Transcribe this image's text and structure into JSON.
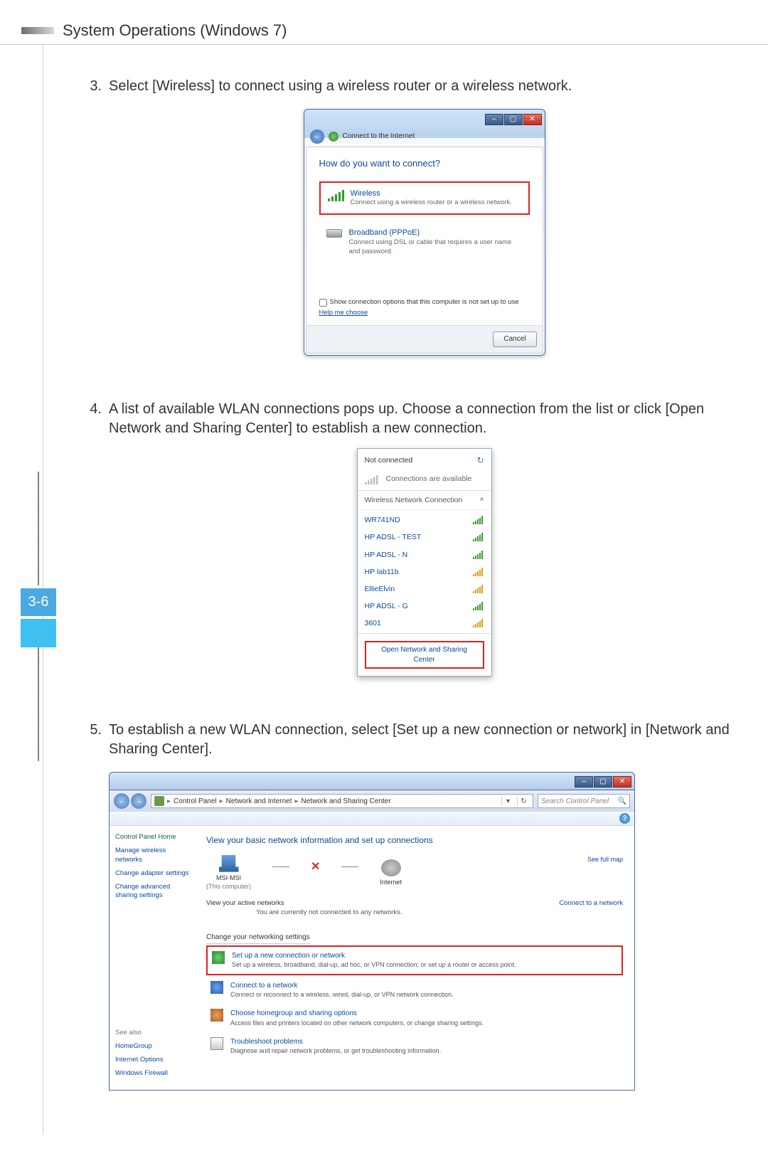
{
  "header": {
    "title": "System Operations (Windows 7)"
  },
  "page_number": "3-6",
  "steps": {
    "s3": {
      "num": "3.",
      "text": "Select [Wireless] to connect using a wireless router or a wireless network."
    },
    "s4": {
      "num": "4.",
      "text": "A list of available WLAN connections pops up. Choose a connection from the list or click [Open Network and Sharing Center] to establish a new connection."
    },
    "s5": {
      "num": "5.",
      "text": "To establish a new WLAN connection, select [Set up a new connection or network] in [Network and Sharing Center]."
    }
  },
  "dialog1": {
    "breadcrumb": "Connect to the Internet",
    "question": "How do you want to connect?",
    "opt_wireless": {
      "title": "Wireless",
      "desc": "Connect using a wireless router or a wireless network."
    },
    "opt_pppoe": {
      "title": "Broadband (PPPoE)",
      "desc": "Connect using DSL or cable that requires a user name and password."
    },
    "show_options": "Show connection options that this computer is not set up to use",
    "help": "Help me choose",
    "cancel": "Cancel"
  },
  "wifi_popup": {
    "not_connected": "Not connected",
    "available": "Connections are available",
    "section": "Wireless Network Connection",
    "items": [
      "WR741ND",
      "HP ADSL - TEST",
      "HP ADSL - N",
      "HP lab11b",
      "EllieElvin",
      "HP ADSL - G",
      "3601"
    ],
    "open_link": "Open Network and Sharing Center"
  },
  "nsc": {
    "crumbs": [
      "Control Panel",
      "Network and Internet",
      "Network and Sharing Center"
    ],
    "search_placeholder": "Search Control Panel",
    "side": {
      "home": "Control Panel Home",
      "links": [
        "Manage wireless networks",
        "Change adapter settings",
        "Change advanced sharing settings"
      ],
      "see_also_label": "See also",
      "see_also": [
        "HomeGroup",
        "Internet Options",
        "Windows Firewall"
      ]
    },
    "main": {
      "heading": "View your basic network information and set up connections",
      "full_map": "See full map",
      "node_pc": "MSI-MSI",
      "node_pc_sub": "(This computer)",
      "node_net": "Internet",
      "active_title": "View your active networks",
      "active_msg": "You are currently not connected to any networks.",
      "connect_link": "Connect to a network",
      "change_title": "Change your networking settings",
      "tasks": [
        {
          "t": "Set up a new connection or network",
          "d": "Set up a wireless, broadband, dial-up, ad hoc, or VPN connection; or set up a router or access point."
        },
        {
          "t": "Connect to a network",
          "d": "Connect or reconnect to a wireless, wired, dial-up, or VPN network connection."
        },
        {
          "t": "Choose homegroup and sharing options",
          "d": "Access files and printers located on other network computers, or change sharing settings."
        },
        {
          "t": "Troubleshoot problems",
          "d": "Diagnose and repair network problems, or get troubleshooting information."
        }
      ]
    }
  }
}
